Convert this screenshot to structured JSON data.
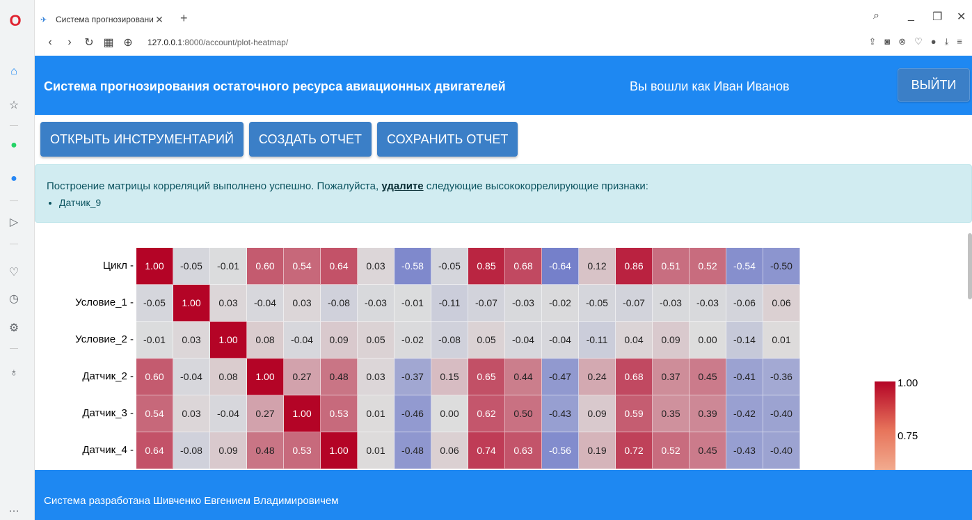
{
  "browser": {
    "tab_title": "Система прогнозировани",
    "tab_close": "✕",
    "new_tab": "+",
    "url_host": "127.0.0.1",
    "url_path": ":8000/account/plot-heatmap/"
  },
  "header": {
    "title": "Система прогнозирования остаточного ресурса авиационных двигателей",
    "user": "Вы вошли как Иван Иванов",
    "logout_label": "ВЫЙТИ"
  },
  "toolbar": {
    "open_tools_label": "ОТКРЫТЬ ИНСТРУМЕНТАРИЙ",
    "create_report_label": "СОЗДАТЬ ОТЧЕТ",
    "save_report_label": "СОХРАНИТЬ ОТЧЕТ"
  },
  "alert": {
    "text_before": "Построение матрицы корреляций выполнено успешно. Пожалуйста, ",
    "text_bold": "удалите",
    "text_after": " следующие высококоррелирующие признаки:",
    "items": [
      "Датчик_9"
    ]
  },
  "chart_data": {
    "type": "heatmap",
    "rows": [
      "Цикл",
      "Условие_1",
      "Условие_2",
      "Датчик_2",
      "Датчик_3",
      "Датчик_4"
    ],
    "values": [
      [
        "1.00",
        "-0.05",
        "-0.01",
        "0.60",
        "0.54",
        "0.64",
        "0.03",
        "-0.58",
        "-0.05",
        "0.85",
        "0.68",
        "-0.64",
        "0.12",
        "0.86",
        "0.51",
        "0.52",
        "-0.54",
        "-0.50"
      ],
      [
        "-0.05",
        "1.00",
        "0.03",
        "-0.04",
        "0.03",
        "-0.08",
        "-0.03",
        "-0.01",
        "-0.11",
        "-0.07",
        "-0.03",
        "-0.02",
        "-0.05",
        "-0.07",
        "-0.03",
        "-0.03",
        "-0.06",
        "0.06"
      ],
      [
        "-0.01",
        "0.03",
        "1.00",
        "0.08",
        "-0.04",
        "0.09",
        "0.05",
        "-0.02",
        "-0.08",
        "0.05",
        "-0.04",
        "-0.04",
        "-0.11",
        "0.04",
        "0.09",
        "0.00",
        "-0.14",
        "0.01"
      ],
      [
        "0.60",
        "-0.04",
        "0.08",
        "1.00",
        "0.27",
        "0.48",
        "0.03",
        "-0.37",
        "0.15",
        "0.65",
        "0.44",
        "-0.47",
        "0.24",
        "0.68",
        "0.37",
        "0.45",
        "-0.41",
        "-0.36"
      ],
      [
        "0.54",
        "0.03",
        "-0.04",
        "0.27",
        "1.00",
        "0.53",
        "0.01",
        "-0.46",
        "0.00",
        "0.62",
        "0.50",
        "-0.43",
        "0.09",
        "0.59",
        "0.35",
        "0.39",
        "-0.42",
        "-0.40"
      ],
      [
        "0.64",
        "-0.08",
        "0.09",
        "0.48",
        "0.53",
        "1.00",
        "0.01",
        "-0.48",
        "0.06",
        "0.74",
        "0.63",
        "-0.56",
        "0.19",
        "0.72",
        "0.52",
        "0.45",
        "-0.43",
        "-0.40"
      ]
    ],
    "colorbar_ticks": [
      "1.00",
      "0.75"
    ],
    "colormap": "coolwarm"
  },
  "footer": {
    "text": "Система разработана Шивченко Евгением Владимировичем"
  }
}
